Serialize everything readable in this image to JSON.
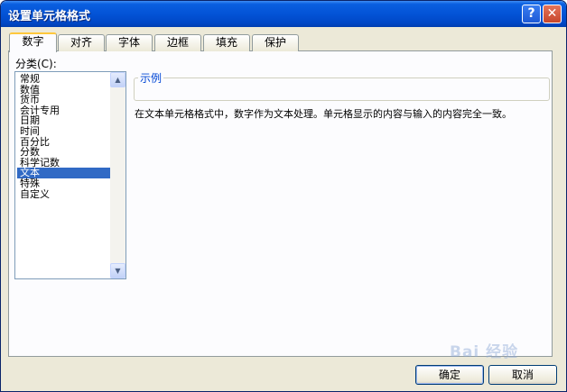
{
  "window": {
    "title": "设置单元格格式",
    "help_glyph": "?",
    "close_glyph": "✕"
  },
  "tabs": [
    {
      "label": "数字",
      "active": true
    },
    {
      "label": "对齐",
      "active": false
    },
    {
      "label": "字体",
      "active": false
    },
    {
      "label": "边框",
      "active": false
    },
    {
      "label": "填充",
      "active": false
    },
    {
      "label": "保护",
      "active": false
    }
  ],
  "category": {
    "label": "分类(C):",
    "items": [
      "常规",
      "数值",
      "货币",
      "会计专用",
      "日期",
      "时间",
      "百分比",
      "分数",
      "科学记数",
      "文本",
      "特殊",
      "自定义"
    ],
    "selected_index": 9
  },
  "sample": {
    "label": "示例",
    "value": ""
  },
  "description": "在文本单元格格式中，数字作为文本处理。单元格显示的内容与输入的内容完全一致。",
  "buttons": {
    "ok": "确定",
    "cancel": "取消"
  },
  "watermark": {
    "text": "Bai 经验"
  },
  "colors": {
    "title_bar": "#0353d6",
    "selection": "#316ac5",
    "sample_label": "#0046d5"
  }
}
